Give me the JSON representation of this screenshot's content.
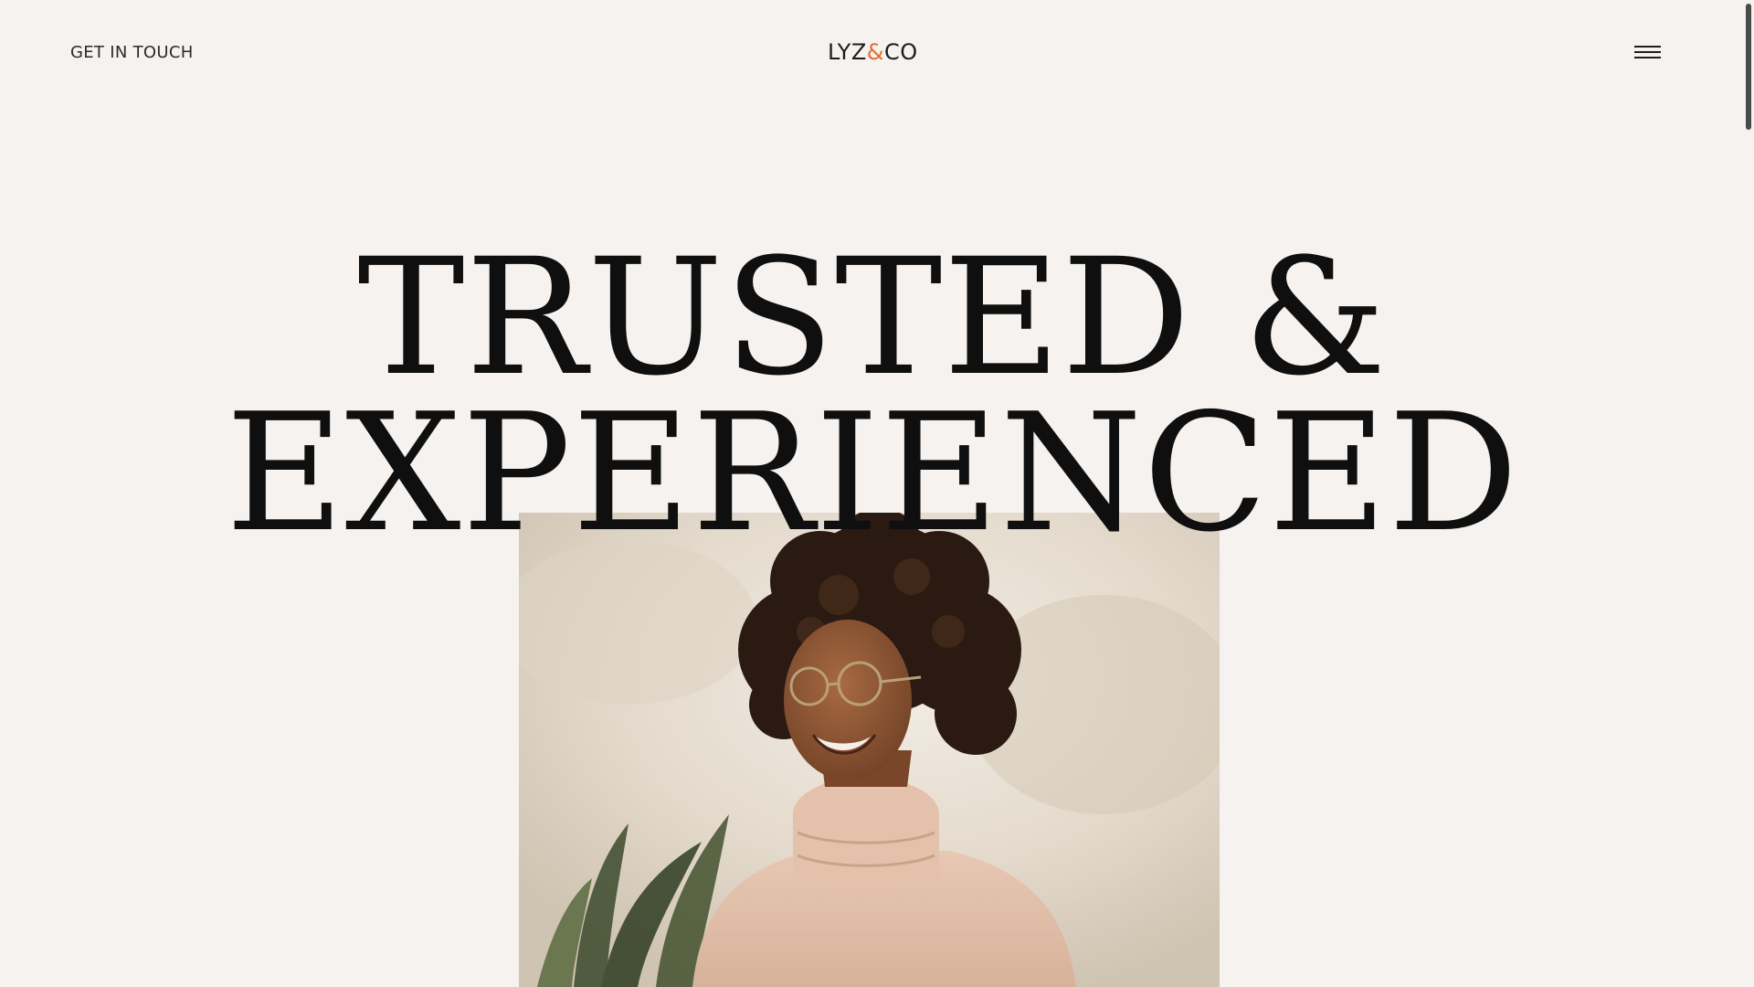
{
  "header": {
    "contact_link": "GET IN TOUCH",
    "logo": {
      "part_before": "LYZ",
      "ampersand": "&",
      "part_after": "CO",
      "accent_color": "#e46c2e"
    },
    "menu_icon": "hamburger-menu-icon"
  },
  "hero": {
    "headline_line_1": "TRUSTED &",
    "headline_line_2": "EXPERIENCED"
  },
  "colors": {
    "background": "#f5f2ef",
    "text": "#0f0f0f"
  }
}
